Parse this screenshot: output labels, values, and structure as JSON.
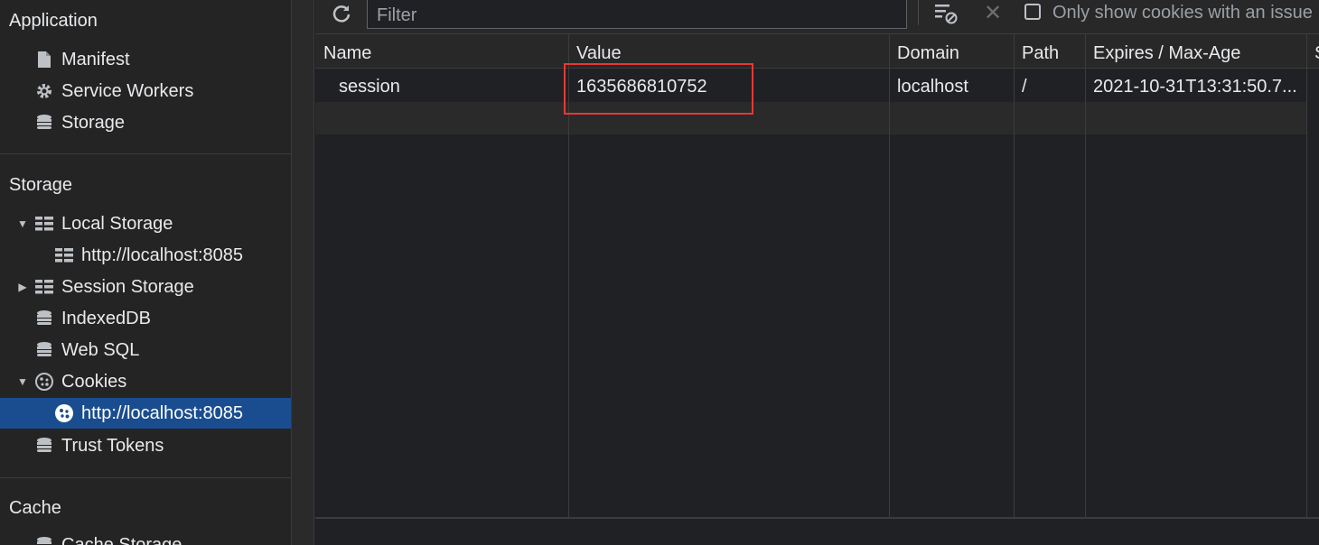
{
  "sidebar": {
    "application": {
      "header": "Application",
      "items": [
        {
          "label": "Manifest",
          "icon": "file-icon"
        },
        {
          "label": "Service Workers",
          "icon": "gear-icon"
        },
        {
          "label": "Storage",
          "icon": "database-icon"
        }
      ]
    },
    "storage": {
      "header": "Storage",
      "items": [
        {
          "label": "Local Storage",
          "icon": "grid-icon",
          "expanded": true
        },
        {
          "label": "http://localhost:8085",
          "icon": "grid-icon"
        },
        {
          "label": "Session Storage",
          "icon": "grid-icon",
          "expanded": false
        },
        {
          "label": "IndexedDB",
          "icon": "database-icon"
        },
        {
          "label": "Web SQL",
          "icon": "database-icon"
        },
        {
          "label": "Cookies",
          "icon": "cookie-icon",
          "expanded": true
        },
        {
          "label": "http://localhost:8085",
          "icon": "cookie-icon",
          "selected": true
        },
        {
          "label": "Trust Tokens",
          "icon": "database-icon"
        }
      ]
    },
    "cache": {
      "header": "Cache",
      "items": [
        {
          "label": "Cache Storage",
          "icon": "database-icon"
        }
      ]
    }
  },
  "toolbar": {
    "filter_placeholder": "Filter",
    "only_issues_label": "Only show cookies with an issue",
    "only_issues_checked": false
  },
  "table": {
    "columns": [
      "Name",
      "Value",
      "Domain",
      "Path",
      "Expires / Max-Age",
      "S"
    ],
    "rows": [
      [
        "session",
        "1635686810752",
        "localhost",
        "/",
        "2021-10-31T13:31:50.7..."
      ]
    ]
  },
  "colors": {
    "selected_bg": "#1a4d8f",
    "highlight_border": "#e53935",
    "panel_bg": "#202124"
  }
}
